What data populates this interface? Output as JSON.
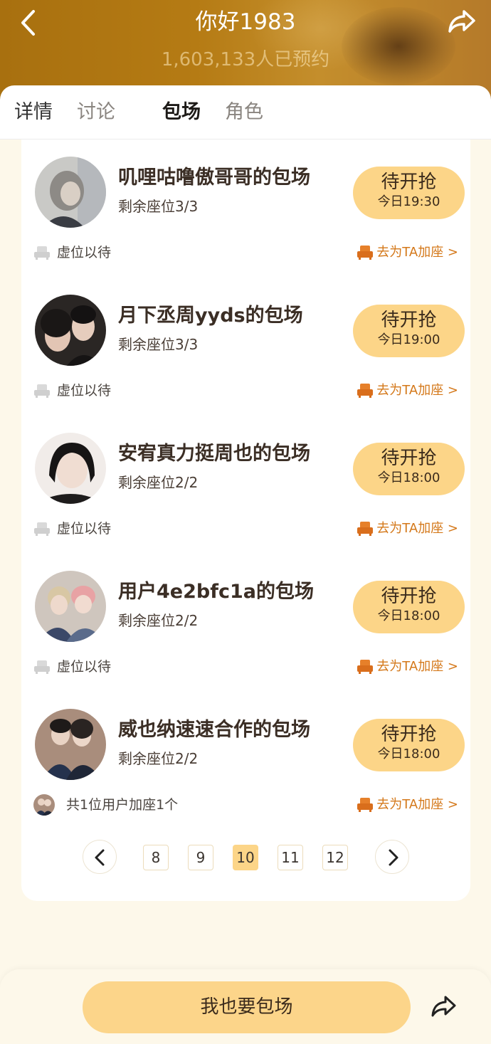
{
  "header": {
    "title": "你好1983",
    "subtitle": "1,603,133人已预约"
  },
  "icons": {
    "back": "chevron-left-icon",
    "share": "share-arrow-icon",
    "seat_empty": "seat-icon",
    "seat_add": "seat-icon"
  },
  "tabs": [
    {
      "label": "详情"
    },
    {
      "label": "讨论"
    },
    {
      "label": "包场",
      "active": true
    },
    {
      "label": "角色"
    }
  ],
  "items": [
    {
      "title": "叽哩咕噜傲哥哥的包场",
      "seats": "剩余座位3/3",
      "button": "待开抢",
      "time": "今日19:30",
      "footer": "虚位以待",
      "action": "去为TA加座 >"
    },
    {
      "title": "月下丞周yyds的包场",
      "seats": "剩余座位3/3",
      "button": "待开抢",
      "time": "今日19:00",
      "footer": "虚位以待",
      "action": "去为TA加座 >"
    },
    {
      "title": "安宥真力挺周也的包场",
      "seats": "剩余座位2/2",
      "button": "待开抢",
      "time": "今日18:00",
      "footer": "虚位以待",
      "action": "去为TA加座 >"
    },
    {
      "title": "用户4e2bfc1a的包场",
      "seats": "剩余座位2/2",
      "button": "待开抢",
      "time": "今日18:00",
      "footer": "虚位以待",
      "action": "去为TA加座 >"
    },
    {
      "title": "威也纳速速合作的包场",
      "seats": "剩余座位2/2",
      "button": "待开抢",
      "time": "今日18:00",
      "footer": "共1位用户加座1个",
      "action": "去为TA加座 >"
    }
  ],
  "pagination": {
    "pages": [
      "8",
      "9",
      "10",
      "11",
      "12"
    ],
    "current": "10"
  },
  "bottom": {
    "button": "我也要包场"
  },
  "colors": {
    "accent": "#fcd588",
    "action_text": "#d4781a",
    "header_bg": "#b57b14"
  }
}
